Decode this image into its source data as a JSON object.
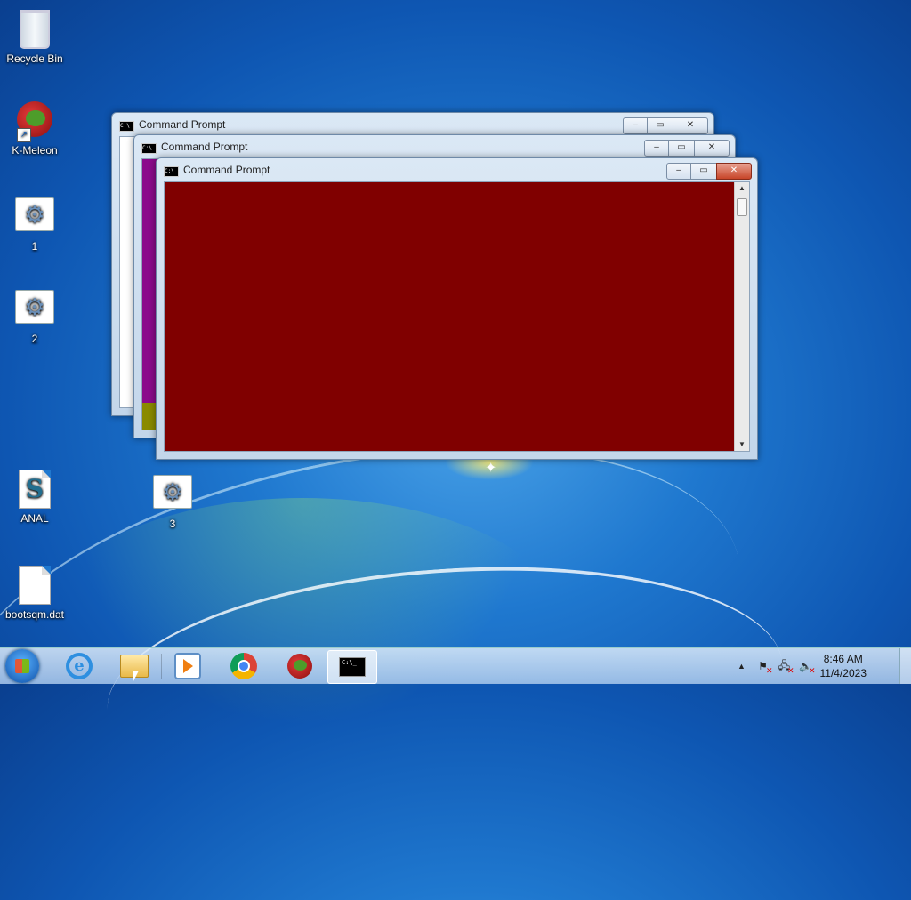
{
  "desktop": {
    "icons": [
      {
        "label": "Recycle Bin",
        "icon": "recycle-bin-icon"
      },
      {
        "label": "K-Meleon",
        "icon": "k-meleon-icon"
      },
      {
        "label": "1",
        "icon": "settings-file-icon"
      },
      {
        "label": "2",
        "icon": "settings-file-icon"
      },
      {
        "label": "ANAL",
        "icon": "script-file-icon"
      },
      {
        "label": "3",
        "icon": "settings-file-icon"
      },
      {
        "label": "bootsqm.dat",
        "icon": "blank-file-icon"
      }
    ]
  },
  "windows": [
    {
      "title": "Command Prompt",
      "console_color": "#ffffff",
      "state": "background"
    },
    {
      "title": "Command Prompt",
      "console_color": "#8b0a8b",
      "state": "background"
    },
    {
      "title": "Command Prompt",
      "console_color": "#800000",
      "state": "active"
    }
  ],
  "window_buttons": {
    "minimize": "–",
    "maximize": "▭",
    "close": "✕"
  },
  "taskbar": {
    "pinned": [
      {
        "name": "Internet Explorer",
        "icon": "internet-explorer-icon"
      },
      {
        "name": "Windows Explorer",
        "icon": "folder-icon"
      },
      {
        "name": "Windows Media Player",
        "icon": "media-player-icon"
      },
      {
        "name": "Google Chrome",
        "icon": "chrome-icon"
      },
      {
        "name": "K-Meleon",
        "icon": "k-meleon-icon"
      },
      {
        "name": "Command Prompt",
        "icon": "command-prompt-icon",
        "active": true
      }
    ],
    "cmd_glyph": "C:\\_",
    "tray": {
      "show_hidden": "▲",
      "time": "8:46 AM",
      "date": "11/4/2023"
    }
  },
  "colors": {
    "accent": "#1f78cf",
    "active_console": "#800000",
    "mid_console": "#8b0a8b"
  }
}
